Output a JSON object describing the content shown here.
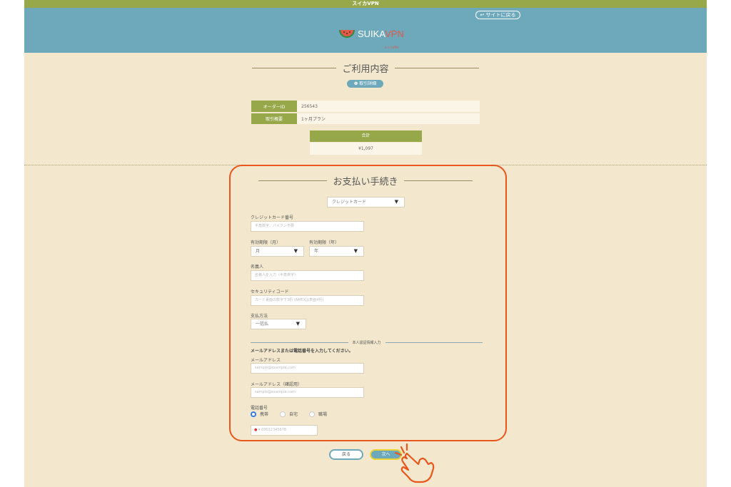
{
  "topbar": {
    "title": "スイカVPN"
  },
  "header": {
    "back_to_site": "サイトに戻る",
    "logo_main": "SUIKA",
    "logo_accent": "VPN",
    "logo_sub": "スイカVPN"
  },
  "usage": {
    "title": "ご利用内容",
    "details_button": "取引詳細",
    "rows": [
      {
        "label": "オーダーID",
        "value": "256543"
      },
      {
        "label": "取引概要",
        "value": "1ヶ月プラン"
      }
    ],
    "total_label": "合計",
    "total_value": "¥1,097"
  },
  "payment": {
    "title": "お支払い手続き",
    "method_select": "クレジットカード",
    "card_number_label": "クレジットカード番号",
    "card_number_placeholder": "半角数字、ハイフン不要",
    "exp_month_label": "有効期限（月）",
    "exp_month_value": "月",
    "exp_year_label": "有効期限（年）",
    "exp_year_value": "年",
    "holder_label": "名義人",
    "holder_placeholder": "名義人を入力（半角英字）",
    "security_label": "セキュリティコード",
    "security_placeholder": "カード裏面の数字下3桁 (AMEXは表面4桁)",
    "pay_method_label": "支払方法",
    "pay_method_value": "一括払",
    "auth_section": "本人認証情報入力",
    "auth_note": "メールアドレスまたは電話番号を入力してください。",
    "email_label": "メールアドレス",
    "email_placeholder": "sample@example.com",
    "email_confirm_label": "メールアドレス（確認用）",
    "email_confirm_placeholder": "sample@example.com",
    "phone_label": "電話番号",
    "phone_types": [
      "携帯",
      "自宅",
      "職場"
    ],
    "phone_placeholder": "09012345678"
  },
  "footer": {
    "back_button": "戻る",
    "next_button": "次へ"
  },
  "colors": {
    "accent": "#6ea8bb",
    "green": "#97a84a",
    "highlight": "#e9561c"
  }
}
